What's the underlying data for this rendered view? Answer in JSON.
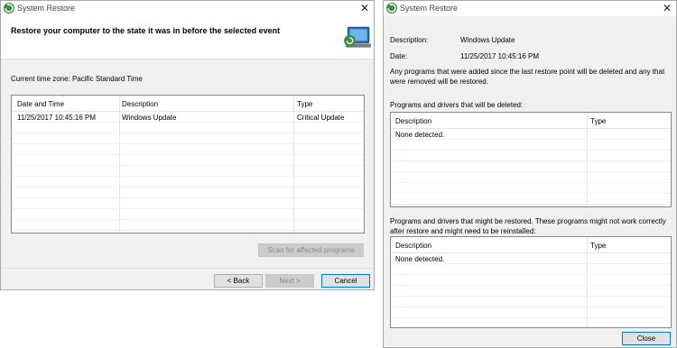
{
  "left_window": {
    "title": "System Restore",
    "heading": "Restore your computer to the state it was in before the selected event",
    "timezone": "Current time zone: Pacific Standard Time",
    "columns": [
      "Date and Time",
      "Description",
      "Type"
    ],
    "rows": [
      [
        "11/25/2017 10:45:16 PM",
        "Windows Update",
        "Critical Update"
      ]
    ],
    "scan_button": "Scan for affected programs",
    "back_button": "< Back",
    "next_button": "Next >",
    "cancel_button": "Cancel"
  },
  "right_window": {
    "title": "System Restore",
    "description_label": "Description:",
    "description_value": "Windows Update",
    "date_label": "Date:",
    "date_value": "11/25/2017 10:45:16 PM",
    "note": "Any programs that were added since the last restore point will be deleted and any that were removed will be restored.",
    "deleted_label": "Programs and drivers that will be deleted:",
    "deleted_columns": [
      "Description",
      "Type"
    ],
    "deleted_empty": "None detected.",
    "restored_label": "Programs and drivers that might be restored. These programs might not work correctly after restore and might need to be reinstalled:",
    "restored_columns": [
      "Description",
      "Type"
    ],
    "restored_empty": "None detected.",
    "close_button": "Close"
  },
  "icons": [
    "system-restore-icon",
    "close-icon",
    "restore-banner-icon",
    "sort-indicator-icon"
  ]
}
